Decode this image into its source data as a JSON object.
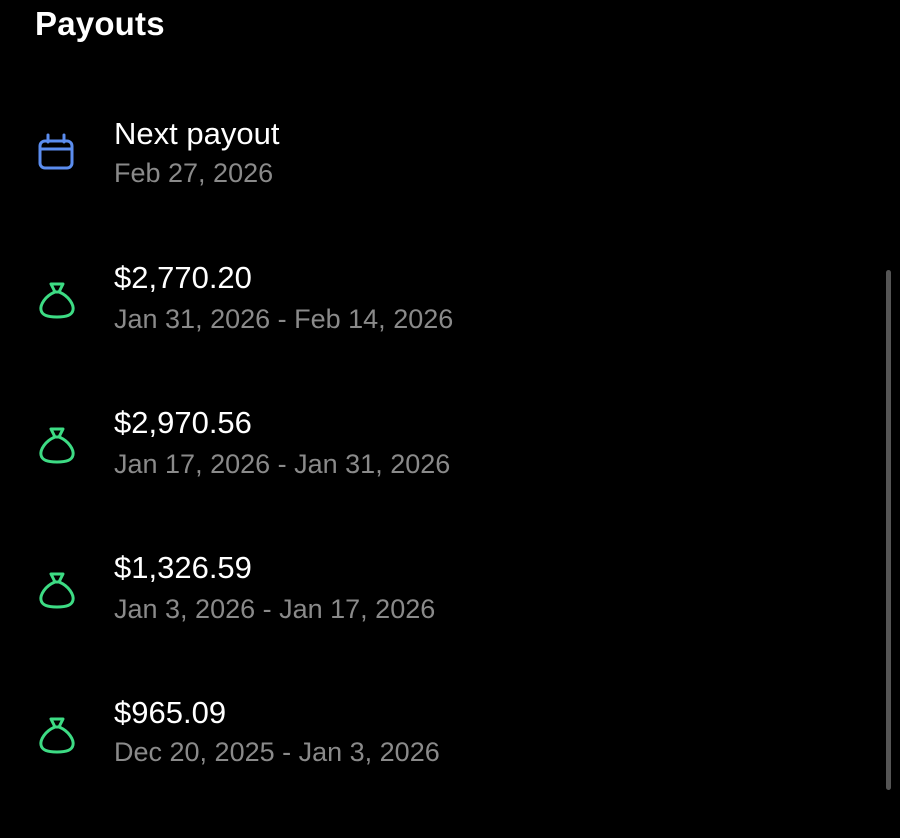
{
  "header": {
    "title": "Payouts"
  },
  "colors": {
    "calendar_icon": "#5b8def",
    "money_bag_icon": "#3ddc84",
    "secondary_text": "#8a8a8a"
  },
  "next_payout": {
    "icon": "calendar-icon",
    "title": "Next payout",
    "date": "Feb 27, 2026"
  },
  "payouts": [
    {
      "icon": "money-bag-icon",
      "amount": "$2,770.20",
      "period": "Jan 31, 2026 - Feb 14, 2026"
    },
    {
      "icon": "money-bag-icon",
      "amount": "$2,970.56",
      "period": "Jan 17, 2026 - Jan 31, 2026"
    },
    {
      "icon": "money-bag-icon",
      "amount": "$1,326.59",
      "period": "Jan 3, 2026 - Jan 17, 2026"
    },
    {
      "icon": "money-bag-icon",
      "amount": "$965.09",
      "period": "Dec 20, 2025 - Jan 3, 2026"
    }
  ]
}
